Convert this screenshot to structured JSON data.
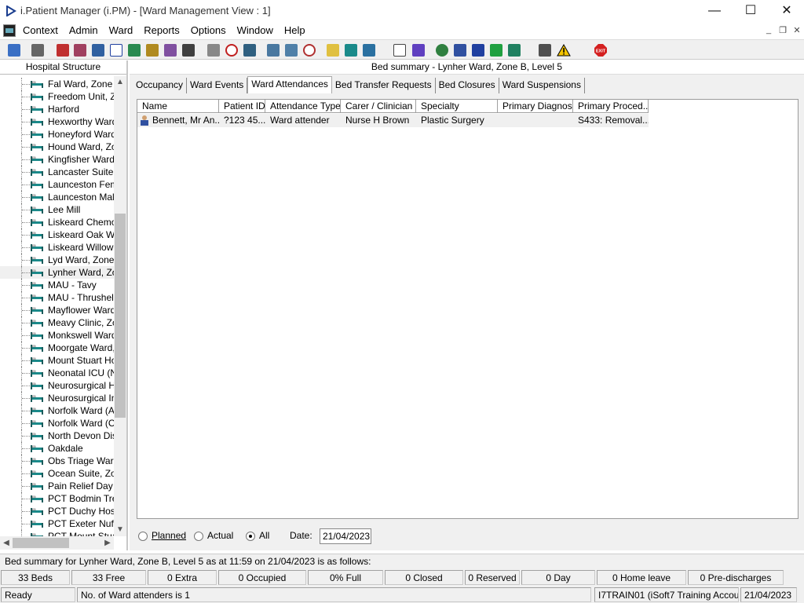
{
  "window": {
    "title": "i.Patient Manager (i.PM) - [Ward Management View : 1]",
    "minimize": "—",
    "maximize": "☐",
    "close": "✕"
  },
  "menu": {
    "items": [
      "Context",
      "Admin",
      "Ward",
      "Reports",
      "Options",
      "Window",
      "Help"
    ]
  },
  "left_panel": {
    "header": "Hospital Structure",
    "wards": [
      "Fal Ward, Zone B",
      "Freedom Unit, Zone",
      "Harford",
      "Hexworthy Ward,",
      "Honeyford Ward,",
      "Hound Ward, Zone",
      "Kingfisher Ward",
      "Lancaster Suite, Z",
      "Launceston Fema",
      "Launceston Male",
      "Lee Mill",
      "Liskeard Chemo D",
      "Liskeard Oak Wa",
      "Liskeard Willow V",
      "Lyd Ward, Zone B",
      "Lynher Ward, Zon",
      "MAU - Tavy",
      "MAU - Thrushel",
      "Mayflower Ward,",
      "Meavy Clinic, Zon",
      "Monkswell Ward,",
      "Moorgate Ward, Z",
      "Mount Stuart Hos",
      "Neonatal ICU (NN",
      "Neurosurgical Hig",
      "Neurosurgical Inte",
      "Norfolk Ward (Ad",
      "Norfolk Ward (Co",
      "North Devon Dist",
      "Oakdale",
      "Obs Triage Ward",
      "Ocean Suite, Zon",
      "Pain Relief Day C",
      "PCT Bodmin Trea",
      "PCT Duchy Hosp",
      "PCT Exeter Nuffie",
      "PCT Mount Stuar"
    ]
  },
  "main": {
    "bed_summary_title": "Bed summary - Lynher Ward, Zone B, Level 5",
    "tabs": [
      "Occupancy",
      "Ward Events",
      "Ward Attendances",
      "Bed Transfer Requests",
      "Bed Closures",
      "Ward Suspensions"
    ],
    "active_tab": "Ward Attendances",
    "columns": [
      "Name",
      "Patient ID",
      "Attendance Type",
      "Carer / Clinician",
      "Specialty",
      "Primary Diagnosis",
      "Primary Proced..."
    ],
    "rows": [
      {
        "name": "Bennett, Mr An...",
        "patient_id": "?123 45...",
        "attendance_type": "Ward attender",
        "clinician": "Nurse H Brown",
        "specialty": "Plastic Surgery",
        "diagnosis": "",
        "procedure": "S433: Removal..."
      }
    ],
    "filter": {
      "planned": "Planned",
      "actual": "Actual",
      "all": "All",
      "selected": "All",
      "date_label": "Date:",
      "date_value": "21/04/2023"
    }
  },
  "summary_line": "Bed summary for Lynher Ward, Zone B, Level 5 as at 11:59 on 21/04/2023 is as follows:",
  "stats": [
    "33 Beds",
    "33 Free",
    "0 Extra",
    "0 Occupied",
    "0% Full",
    "0 Closed",
    "0 Reserved",
    "0 Day",
    "0 Home leave",
    "0 Pre-discharges"
  ],
  "statusbar": {
    "state": "Ready",
    "message": "No. of Ward attenders is 1",
    "account": "I7TRAIN01 (iSoft7 Training Account)",
    "date": "21/04/2023"
  },
  "colors": {
    "exit_red": "#d42020",
    "warning_yellow": "#f4c400",
    "bed_teal": "#1a8a8a"
  }
}
